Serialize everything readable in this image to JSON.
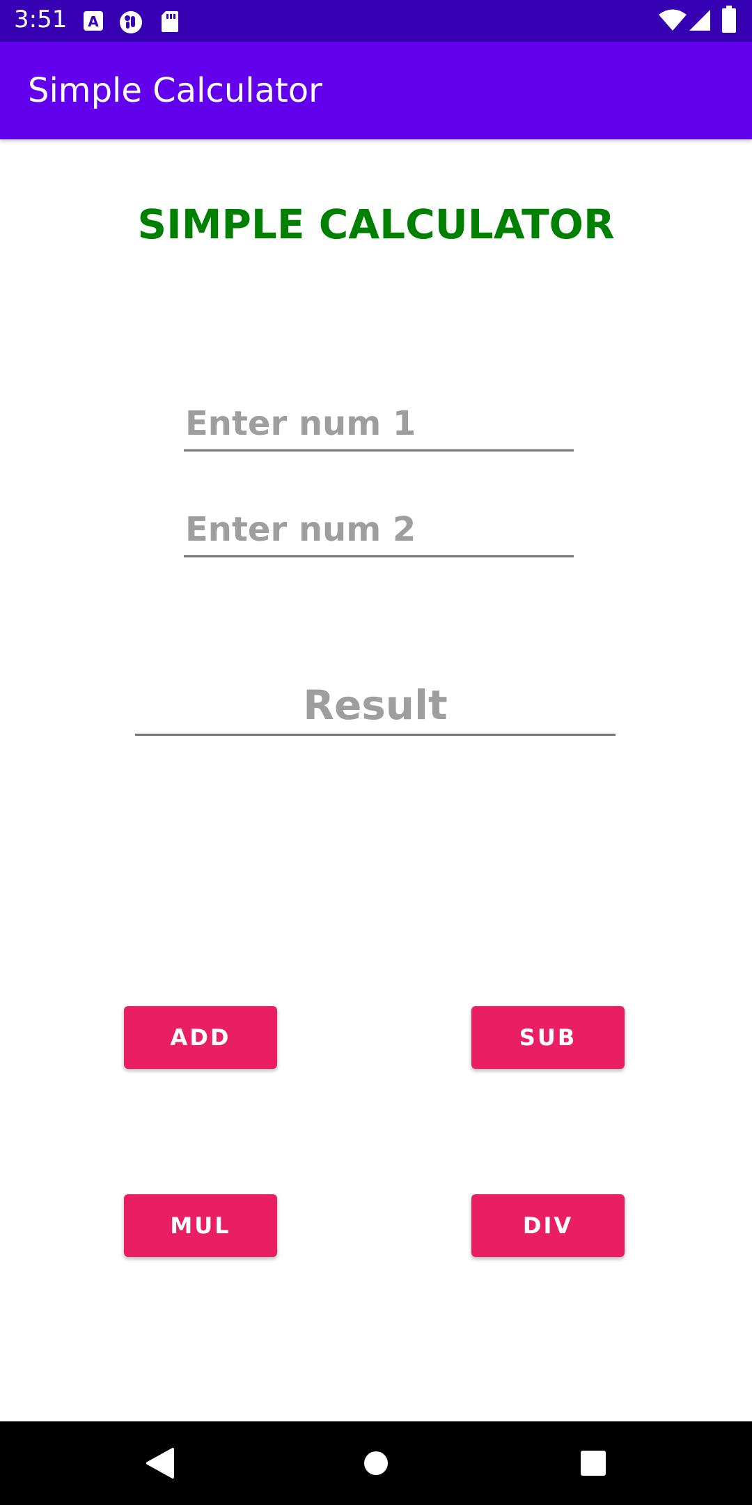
{
  "status_bar": {
    "time": "3:51",
    "left_icons": [
      "a-font-icon",
      "podcast-icon",
      "sd-card-icon"
    ],
    "right_icons": [
      "wifi-icon",
      "signal-icon",
      "battery-icon"
    ]
  },
  "app_bar": {
    "title": "Simple Calculator"
  },
  "main": {
    "heading": "SIMPLE CALCULATOR",
    "num1_placeholder": "Enter num 1",
    "num2_placeholder": "Enter num 2",
    "result_placeholder": "Result",
    "buttons": {
      "add": "ADD",
      "sub": "SUB",
      "mul": "MUL",
      "div": "DIV"
    }
  },
  "nav_bar": {
    "icons": [
      "back-icon",
      "home-icon",
      "recents-icon"
    ]
  },
  "colors": {
    "status_bar": "#3700b3",
    "app_bar": "#6200ee",
    "heading": "#008000",
    "button": "#e91e63",
    "placeholder": "#9e9e9e",
    "nav_bar": "#000000"
  }
}
